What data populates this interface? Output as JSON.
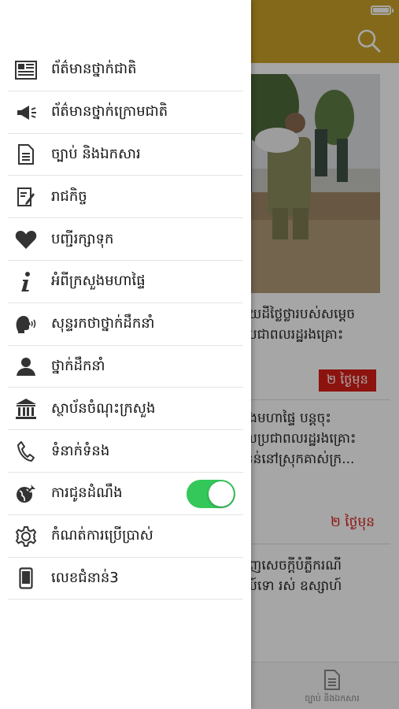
{
  "menu": {
    "items": [
      {
        "label": "ព័ត៌មានថ្នាក់ជាតិ",
        "icon": "newspaper-icon"
      },
      {
        "label": "ព័ត៌មានថ្នាក់ក្រោមជាតិ",
        "icon": "megaphone-icon"
      },
      {
        "label": "ច្បាប់ និងឯកសារ",
        "icon": "document-icon"
      },
      {
        "label": "រាជកិច្ច",
        "icon": "edit-document-icon"
      },
      {
        "label": "បញ្ជីរក្សាទុក",
        "icon": "heart-icon"
      },
      {
        "label": "អំពីក្រសួងមហាផ្ទៃ",
        "icon": "info-icon"
      },
      {
        "label": "សុន្ទរកថាថ្នាក់ដឹកនាំ",
        "icon": "speaking-head-icon"
      },
      {
        "label": "ថ្នាក់ដឹកនាំ",
        "icon": "person-icon"
      },
      {
        "label": "ស្ថាប័នចំណុះក្រសួង",
        "icon": "institution-icon"
      },
      {
        "label": "ទំនាក់ទំនង",
        "icon": "phone-icon"
      },
      {
        "label": "ការជូនដំណឹង",
        "icon": "globe-notification-icon",
        "toggle_on": true
      },
      {
        "label": "កំណត់ការប្រើប្រាស់",
        "icon": "gear-icon"
      },
      {
        "label": "លេខជំនាន់3",
        "icon": "mobile-phone-icon"
      }
    ]
  },
  "background": {
    "article1_line1": "កាយដីថ្លៃថ្លារបស់សម្តេច",
    "article1_line2": "នប្រជាពលរដ្ឋរងគ្រោះ",
    "badge1": "២ ថ្ងៃមុន",
    "article2_line1": "សួងមហាផ្ទៃ បន្តចុះ",
    "article2_line2": "ងលប្រជាពលរដ្ឋរងគ្រោះ",
    "article2_line3": "ជំនន់នៅស្រុកគាស់ក្រ...",
    "time2": "២ ថ្ងៃមុន",
    "article3_line1": "ចេញសេចក្តីបំភ្លឺករណី",
    "article3_line2": "នីយ៍ទោ រស់ ឧស្សាហ៍",
    "tab_label": "ច្បាប់ និងឯកសារ"
  },
  "colors": {
    "header": "#c9a227",
    "toggle": "#34c759",
    "badge": "#d91e18"
  }
}
